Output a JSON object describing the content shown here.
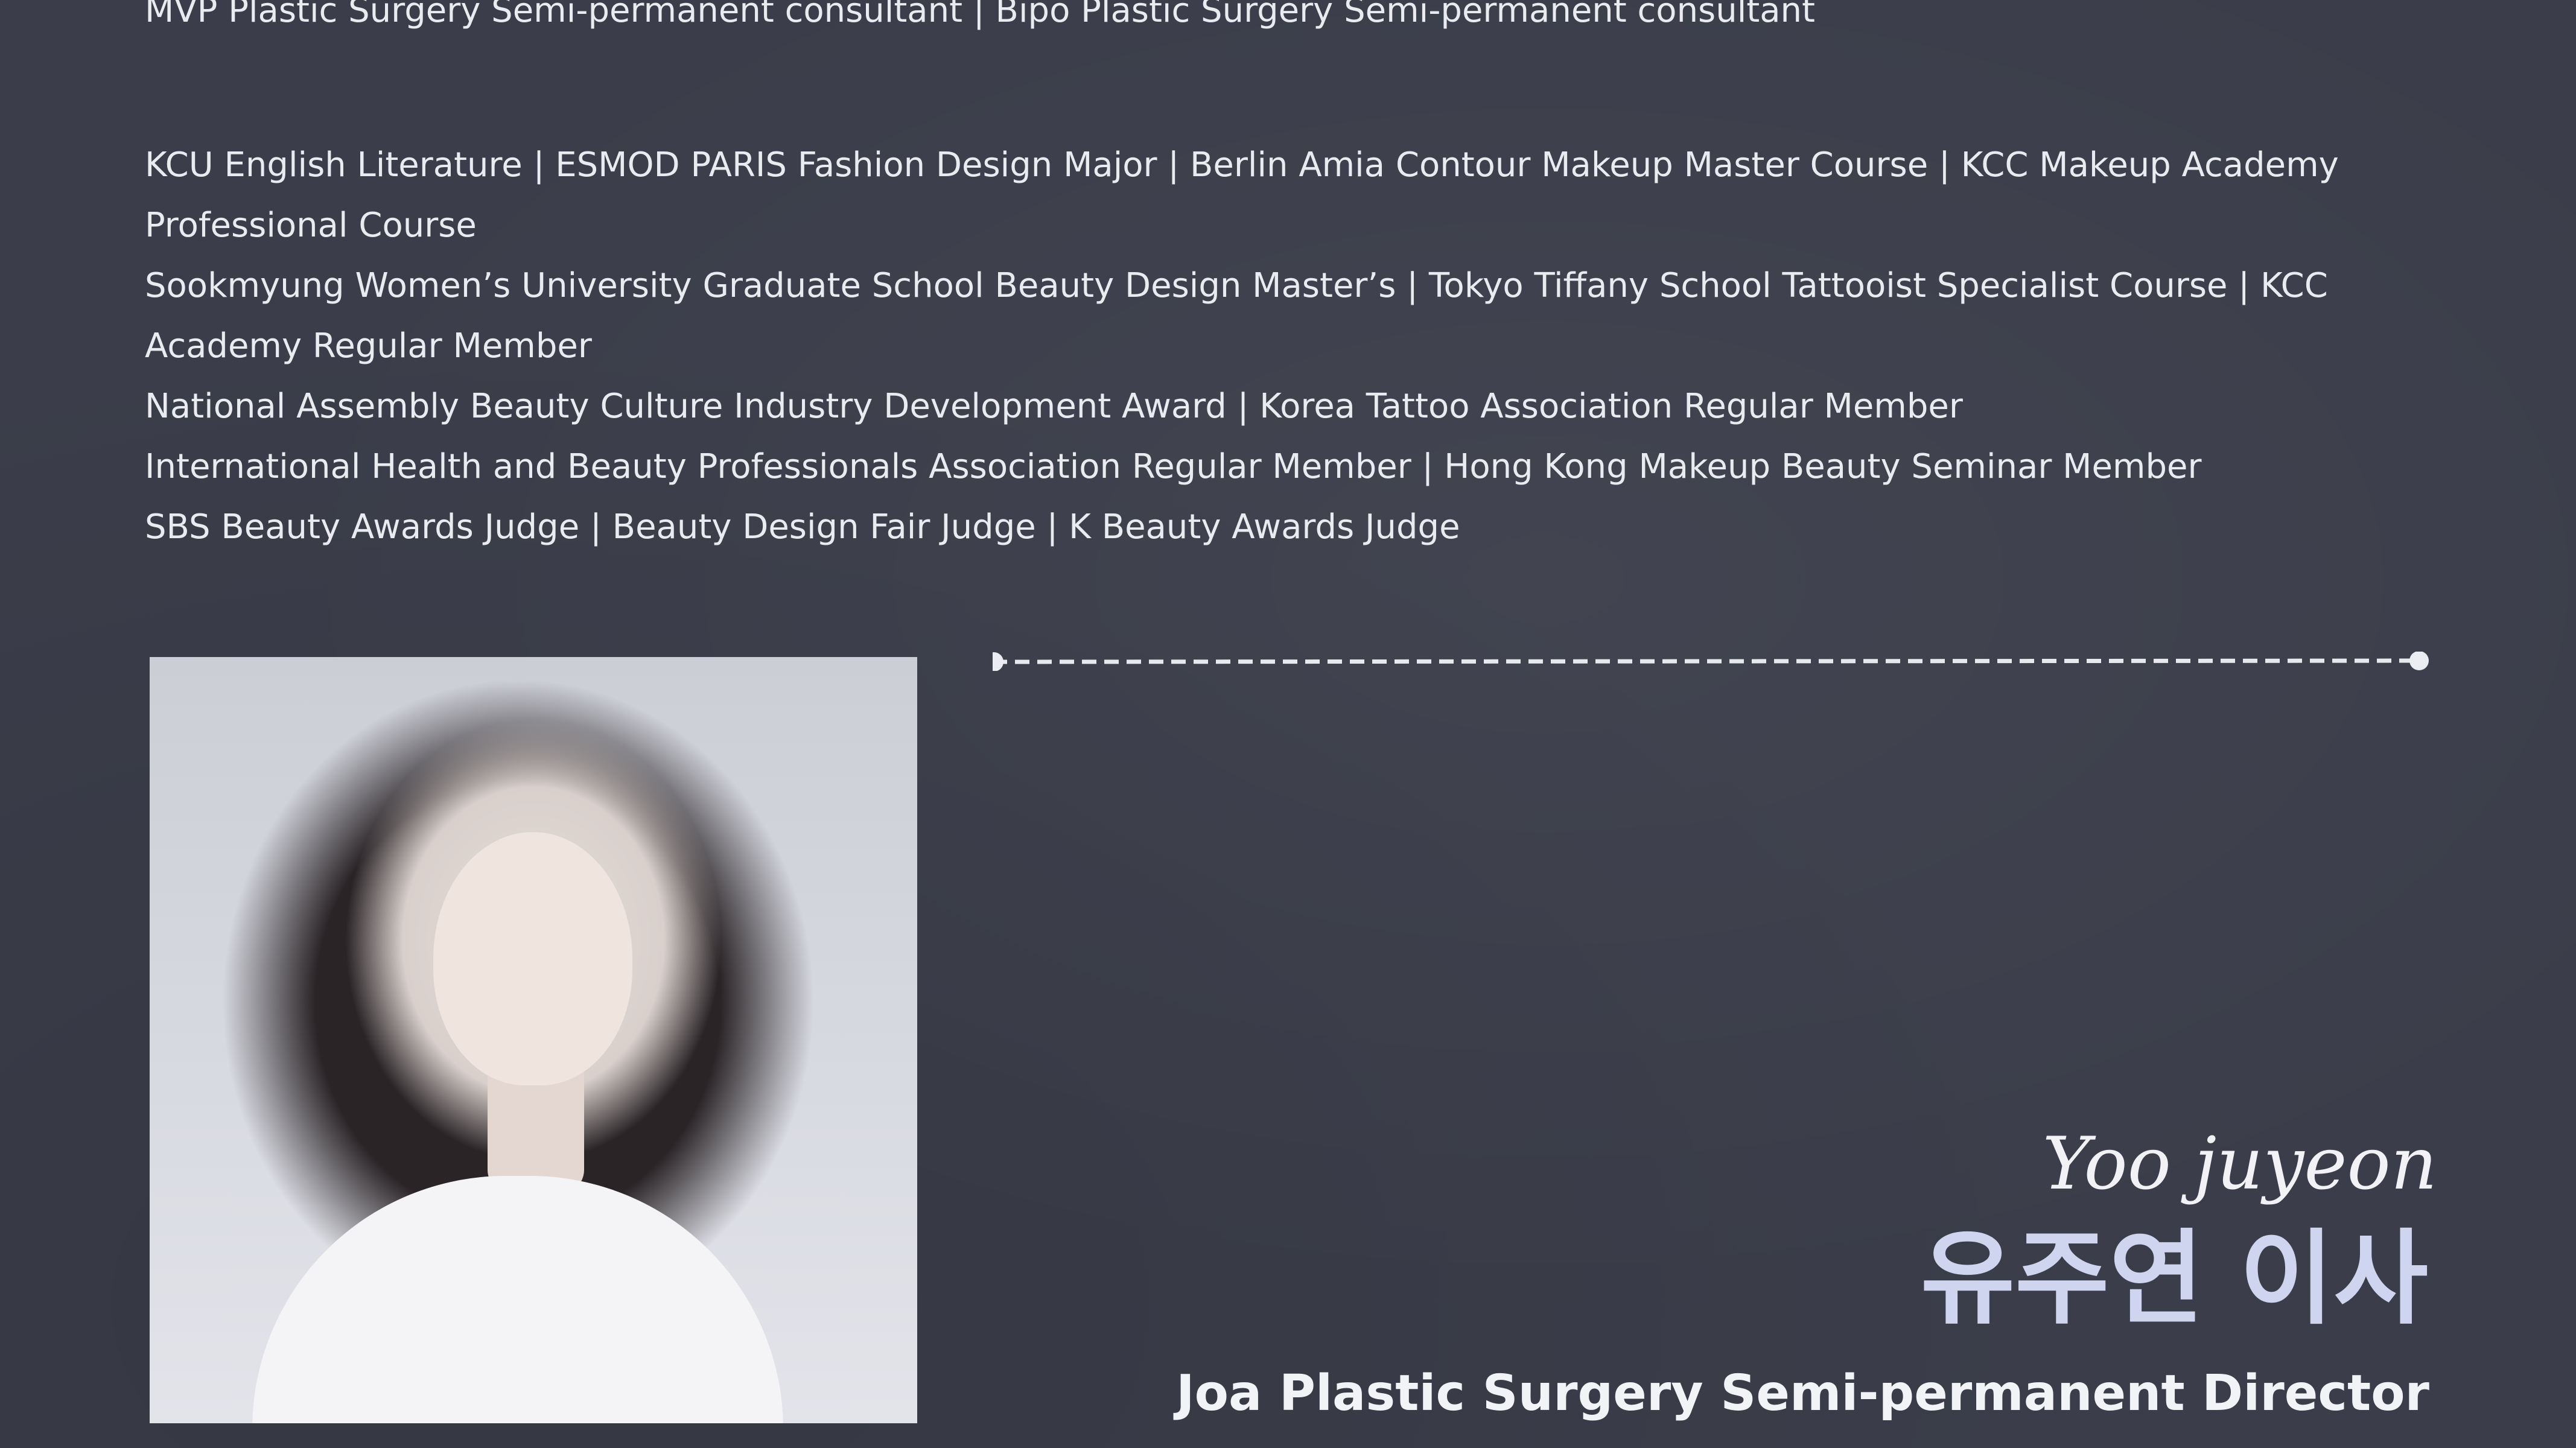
{
  "top_line": "MVP Plastic Surgery Semi-permanent consultant  |  Bipo Plastic Surgery Semi-permanent consultant",
  "credentials": [
    "KCU English Literature  |  ESMOD PARIS Fashion Design Major  |  Berlin Amia Contour Makeup Master Course  |  KCC Makeup Academy Professional Course",
    "Sookmyung Women’s University Graduate School Beauty Design Master’s  |  Tokyo Tiffany School Tattooist Specialist Course  |  KCC Academy Regular Member",
    "National Assembly Beauty Culture Industry Development Award  |  Korea Tattoo Association Regular Member",
    "International Health and Beauty Professionals Association Regular Member  |  Hong Kong Makeup Beauty Seminar Member",
    "SBS Beauty Awards Judge  |  Beauty Design Fair Judge  |  K Beauty Awards Judge"
  ],
  "profile": {
    "script_name": "Yoo juyeon",
    "korean_name": "유주연 이사",
    "title": "Joa Plastic Surgery Semi-permanent Director"
  },
  "colors": {
    "background": "#3b3e4a",
    "text": "#e9ebf1",
    "korean_name": "#cfd5ee"
  }
}
